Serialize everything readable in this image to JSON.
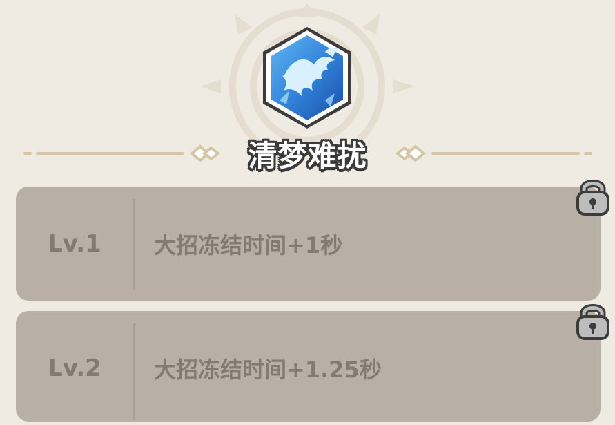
{
  "skill": {
    "icon": "phoenix-ice-icon",
    "title": "清梦难扰"
  },
  "levels": [
    {
      "level": "Lv.1",
      "description": "大招冻结时间+1秒",
      "locked": true,
      "icon": "lock-icon"
    },
    {
      "level": "Lv.2",
      "description": "大招冻结时间+1.25秒",
      "locked": true,
      "icon": "lock-icon"
    }
  ],
  "colors": {
    "background": "#efebe2",
    "card": "#b8b0a4",
    "card_text": "#847a6d",
    "icon_blue": "#2f7fd6",
    "divider_gold": "#d6c6a6"
  }
}
